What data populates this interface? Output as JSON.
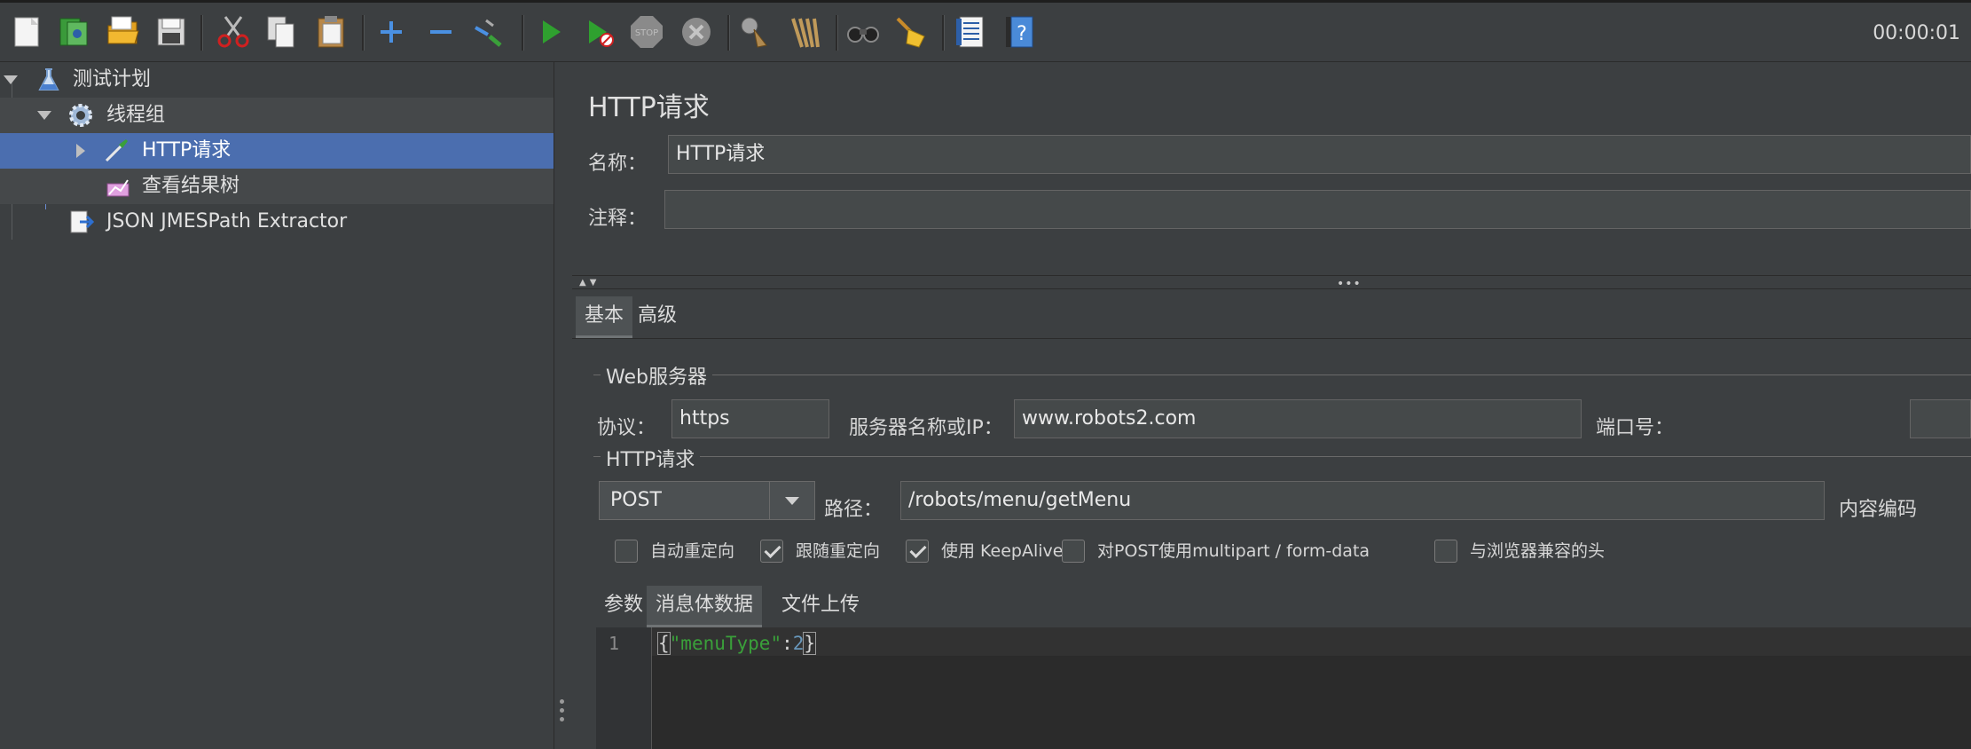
{
  "toolbar": {
    "timer": "00:00:01",
    "icons": [
      "new-icon",
      "templates-icon",
      "open-icon",
      "save-icon",
      "cut-icon",
      "copy-icon",
      "paste-icon",
      "expand-icon",
      "collapse-icon",
      "toggle-icon",
      "start-icon",
      "start-no-pause-icon",
      "stop-icon",
      "shutdown-icon",
      "clear-icon",
      "clear-all-icon",
      "search-icon",
      "reset-search-icon",
      "function-helper-icon",
      "help-icon"
    ]
  },
  "tree": {
    "items": [
      {
        "label": "测试计划"
      },
      {
        "label": "线程组"
      },
      {
        "label": "HTTP请求"
      },
      {
        "label": "查看结果树"
      },
      {
        "label": "JSON JMESPath Extractor"
      }
    ]
  },
  "panel": {
    "title": "HTTP请求",
    "name_label": "名称：",
    "name_value": "HTTP请求",
    "comment_label": "注释：",
    "comment_value": "",
    "tabs": [
      {
        "label": "基本"
      },
      {
        "label": "高级"
      }
    ],
    "web_server_title": "Web服务器",
    "protocol_label": "协议：",
    "protocol_value": "https",
    "server_label": "服务器名称或IP：",
    "server_value": "www.robots2.com",
    "port_label": "端口号：",
    "port_value": "",
    "http_request_title": "HTTP请求",
    "method": "POST",
    "path_label": "路径：",
    "path_value": "/robots/menu/getMenu",
    "encoding_label": "内容编码",
    "checkboxes": [
      {
        "label": "自动重定向",
        "checked": false
      },
      {
        "label": "跟随重定向",
        "checked": true
      },
      {
        "label": "使用 KeepAlive",
        "checked": true
      },
      {
        "label": "对POST使用multipart / form-data",
        "checked": false
      },
      {
        "label": "与浏览器兼容的头",
        "checked": false
      }
    ],
    "subtabs": [
      {
        "label": "参数"
      },
      {
        "label": "消息体数据"
      },
      {
        "label": "文件上传"
      }
    ],
    "editor": {
      "line_number": "1",
      "open_brace": "{",
      "key": "\"menuType\"",
      "colon": ":",
      "value": "2",
      "close_brace": "}"
    }
  },
  "colors": {
    "selection": "#4b6eaf",
    "background": "#3c3f41",
    "editor_string": "#6a8759",
    "editor_number": "#6897bb"
  }
}
